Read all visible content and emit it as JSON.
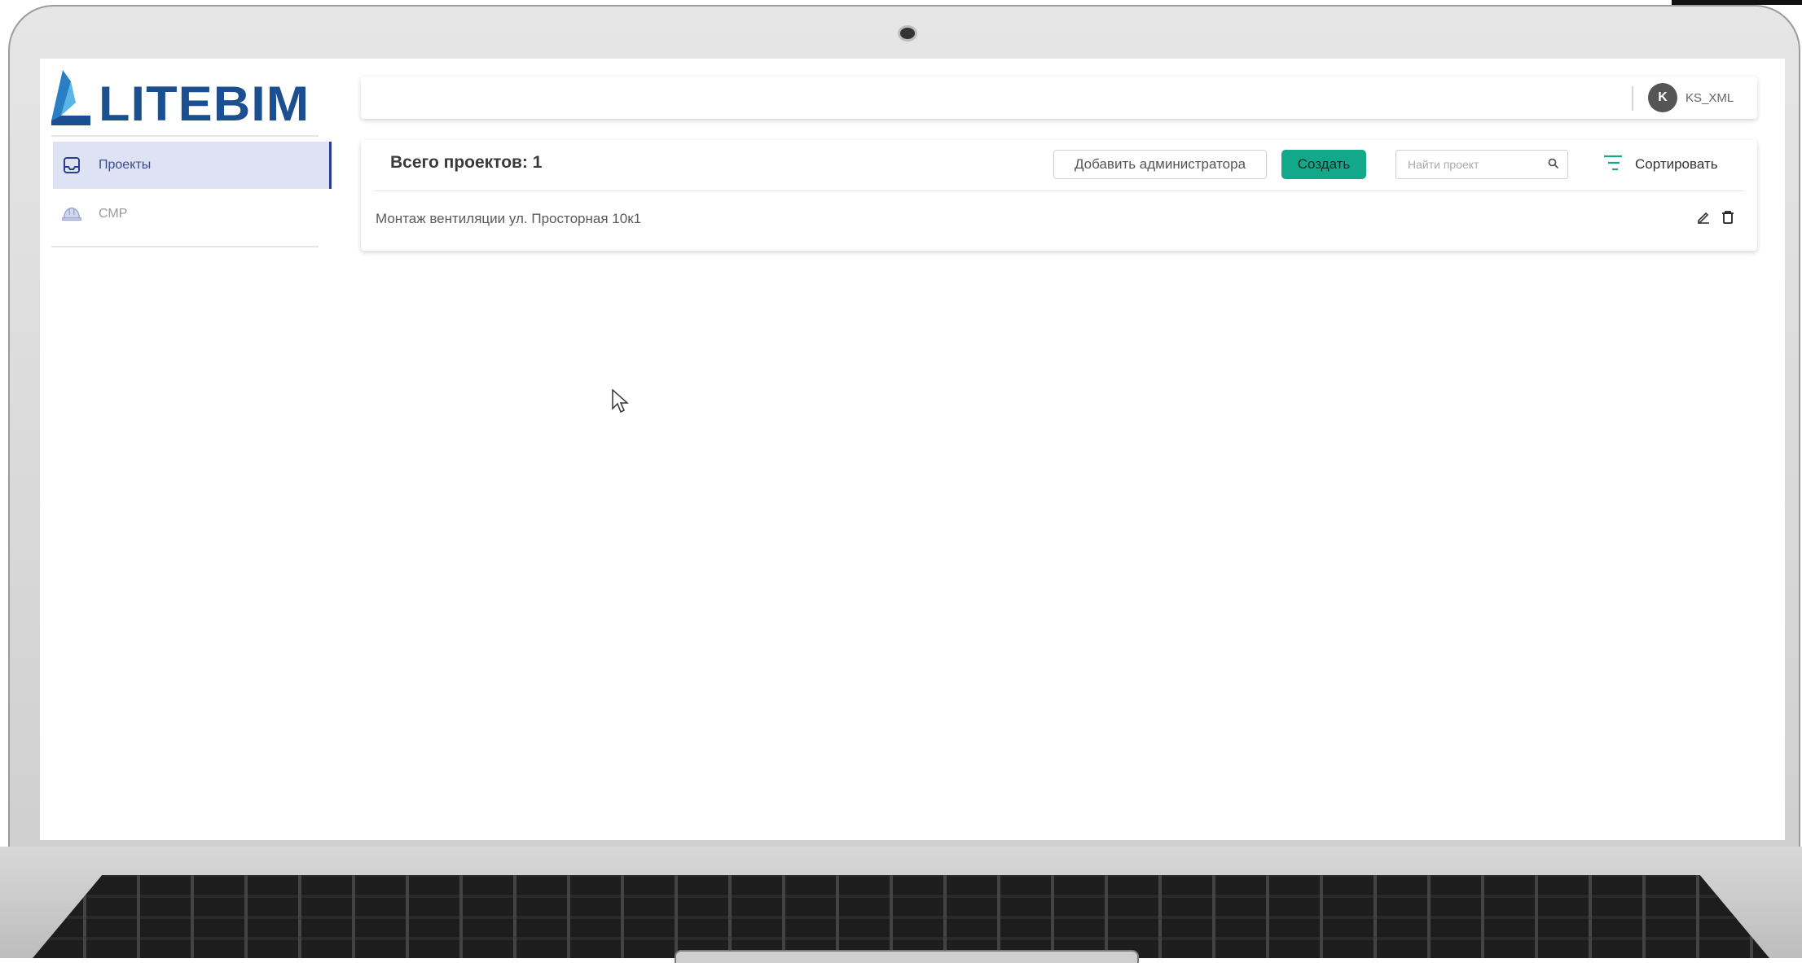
{
  "app": {
    "logo_text": "LITEBIM"
  },
  "sidebar": {
    "items": [
      {
        "label": "Проекты",
        "icon": "inbox-icon",
        "active": true
      },
      {
        "label": "СМР",
        "icon": "hard-hat-icon",
        "active": false
      }
    ]
  },
  "header": {
    "avatar_initial": "K",
    "username": "KS_XML"
  },
  "projects": {
    "title": "Всего проектов: 1",
    "add_admin_label": "Добавить администратора",
    "create_label": "Создать",
    "search_placeholder": "Найти проект",
    "sort_label": "Сортировать",
    "items": [
      {
        "name": "Монтаж вентиляции ул. Просторная 10к1"
      }
    ]
  },
  "colors": {
    "accent": "#12a98b",
    "brand": "#1b4f8f",
    "active_nav_bg": "#dde3f5"
  }
}
